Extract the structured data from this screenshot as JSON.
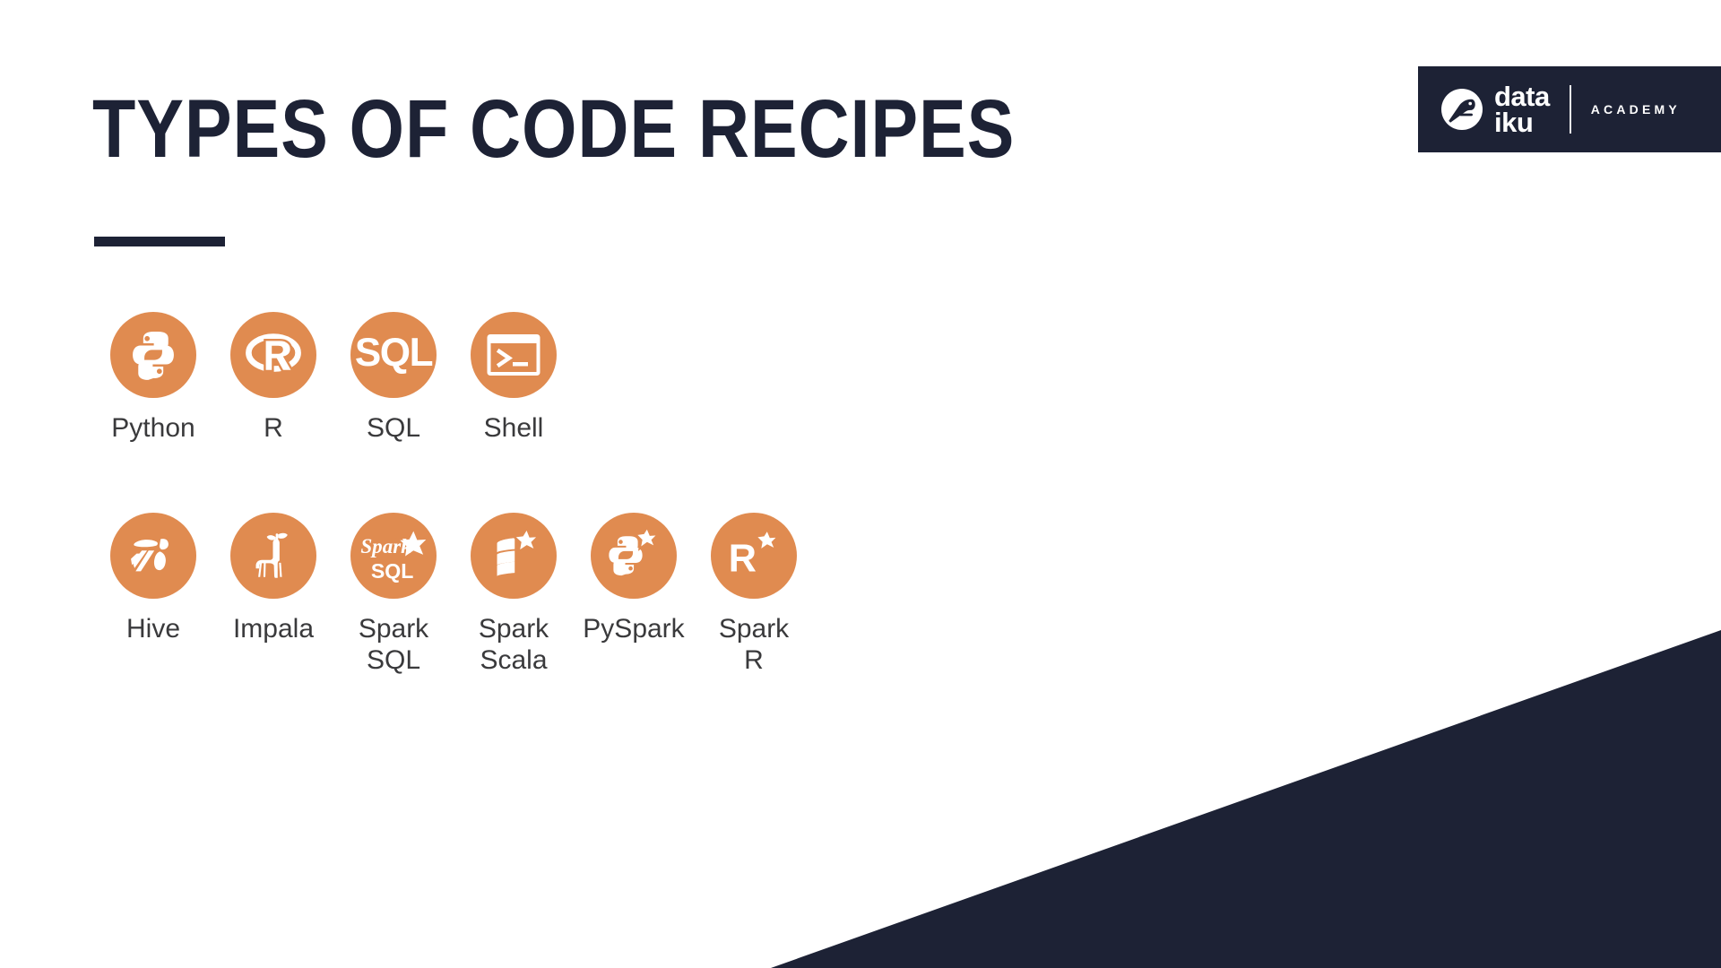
{
  "slide": {
    "title": "TYPES OF CODE RECIPES",
    "background_color": "#FFFFFF",
    "accent_color": "#E08B50",
    "dark_color": "#1D2235"
  },
  "logo": {
    "bird_icon": "dataiku-bird-icon",
    "wordmark_line1": "data",
    "wordmark_line2": "iku",
    "academy_label": "ACADEMY"
  },
  "recipe_groups": [
    {
      "id": "basic",
      "items": [
        {
          "label": "Python",
          "icon": "python-icon"
        },
        {
          "label": "R",
          "icon": "r-icon"
        },
        {
          "label": "SQL",
          "icon": "sql-icon"
        },
        {
          "label": "Shell",
          "icon": "shell-icon"
        }
      ]
    },
    {
      "id": "spark",
      "items": [
        {
          "label": "Hive",
          "icon": "hive-bee-icon"
        },
        {
          "label": "Impala",
          "icon": "impala-antelope-icon"
        },
        {
          "label": "Spark\nSQL",
          "icon": "spark-sql-icon"
        },
        {
          "label": "Spark\nScala",
          "icon": "spark-scala-icon"
        },
        {
          "label": "PySpark",
          "icon": "pyspark-icon"
        },
        {
          "label": "Spark\nR",
          "icon": "spark-r-icon"
        }
      ]
    }
  ]
}
